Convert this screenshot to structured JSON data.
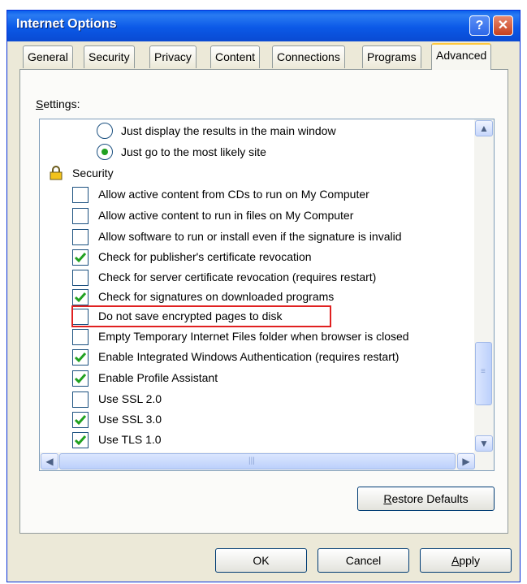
{
  "window": {
    "title": "Internet Options",
    "help_label": "?",
    "close_label": "✕"
  },
  "tabs": [
    {
      "label": "General"
    },
    {
      "label": "Security"
    },
    {
      "label": "Privacy"
    },
    {
      "label": "Content"
    },
    {
      "label": "Connections"
    },
    {
      "label": "Programs"
    },
    {
      "label": "Advanced",
      "active": true
    }
  ],
  "settings_label": {
    "mnemonic": "S",
    "rest": "ettings:"
  },
  "settings": {
    "radio_items": [
      {
        "label": "Just display the results in the main window",
        "checked": false
      },
      {
        "label": "Just go to the most likely site",
        "checked": true
      }
    ],
    "group_label": "Security",
    "items": [
      {
        "label": "Allow active content from CDs to run on My Computer",
        "checked": false
      },
      {
        "label": "Allow active content to run in files on My Computer",
        "checked": false
      },
      {
        "label": "Allow software to run or install even if the signature is invalid",
        "checked": false
      },
      {
        "label": "Check for publisher's certificate revocation",
        "checked": true
      },
      {
        "label": "Check for server certificate revocation (requires restart)",
        "checked": false
      },
      {
        "label": "Check for signatures on downloaded programs",
        "checked": true
      },
      {
        "label": "Do not save encrypted pages to disk",
        "checked": false
      },
      {
        "label": "Empty Temporary Internet Files folder when browser is closed",
        "checked": false
      },
      {
        "label": "Enable Integrated Windows Authentication (requires restart)",
        "checked": true
      },
      {
        "label": "Enable Profile Assistant",
        "checked": true
      },
      {
        "label": "Use SSL 2.0",
        "checked": false
      },
      {
        "label": "Use SSL 3.0",
        "checked": true
      },
      {
        "label": "Use TLS 1.0",
        "checked": true
      }
    ]
  },
  "buttons": {
    "restore_defaults": {
      "mnemonic": "R",
      "rest": "estore Defaults"
    },
    "ok": "OK",
    "cancel": "Cancel",
    "apply": {
      "mnemonic": "A",
      "rest": "pply"
    }
  },
  "colors": {
    "check": "#21a121",
    "highlight_box": "#e02020",
    "titlebar": "#0a5fec"
  }
}
